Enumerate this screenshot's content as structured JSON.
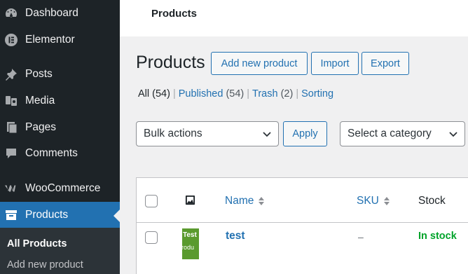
{
  "sidebar": {
    "items": [
      {
        "label": "Dashboard",
        "icon": "dashboard-icon"
      },
      {
        "label": "Elementor",
        "icon": "elementor-icon"
      },
      {
        "label": "Posts",
        "icon": "pin-icon"
      },
      {
        "label": "Media",
        "icon": "media-icon"
      },
      {
        "label": "Pages",
        "icon": "pages-icon"
      },
      {
        "label": "Comments",
        "icon": "comments-icon"
      },
      {
        "label": "WooCommerce",
        "icon": "woocommerce-icon"
      },
      {
        "label": "Products",
        "icon": "archive-icon",
        "active": true
      }
    ],
    "submenu": [
      "All Products",
      "Add new product"
    ]
  },
  "topbar": {
    "title": "Products"
  },
  "page": {
    "title": "Products",
    "add_new_label": "Add new product",
    "import_label": "Import",
    "export_label": "Export"
  },
  "views": {
    "all": {
      "label": "All",
      "count": "(54)"
    },
    "published": {
      "label": "Published",
      "count": "(54)"
    },
    "trash": {
      "label": "Trash",
      "count": "(2)"
    },
    "sorting": {
      "label": "Sorting"
    },
    "separator": "|"
  },
  "filters": {
    "bulk_actions": "Bulk actions",
    "apply_label": "Apply",
    "category": "Select a category"
  },
  "table": {
    "columns": {
      "name": "Name",
      "sku": "SKU",
      "stock": "Stock"
    },
    "rows": [
      {
        "thumb_line1": "Test",
        "thumb_line2": "rodu",
        "name": "test",
        "sku": "–",
        "stock": "In stock"
      }
    ]
  },
  "colors": {
    "accent": "#2271b1",
    "sidebar_bg": "#1d2327",
    "in_stock": "#00a32a"
  }
}
